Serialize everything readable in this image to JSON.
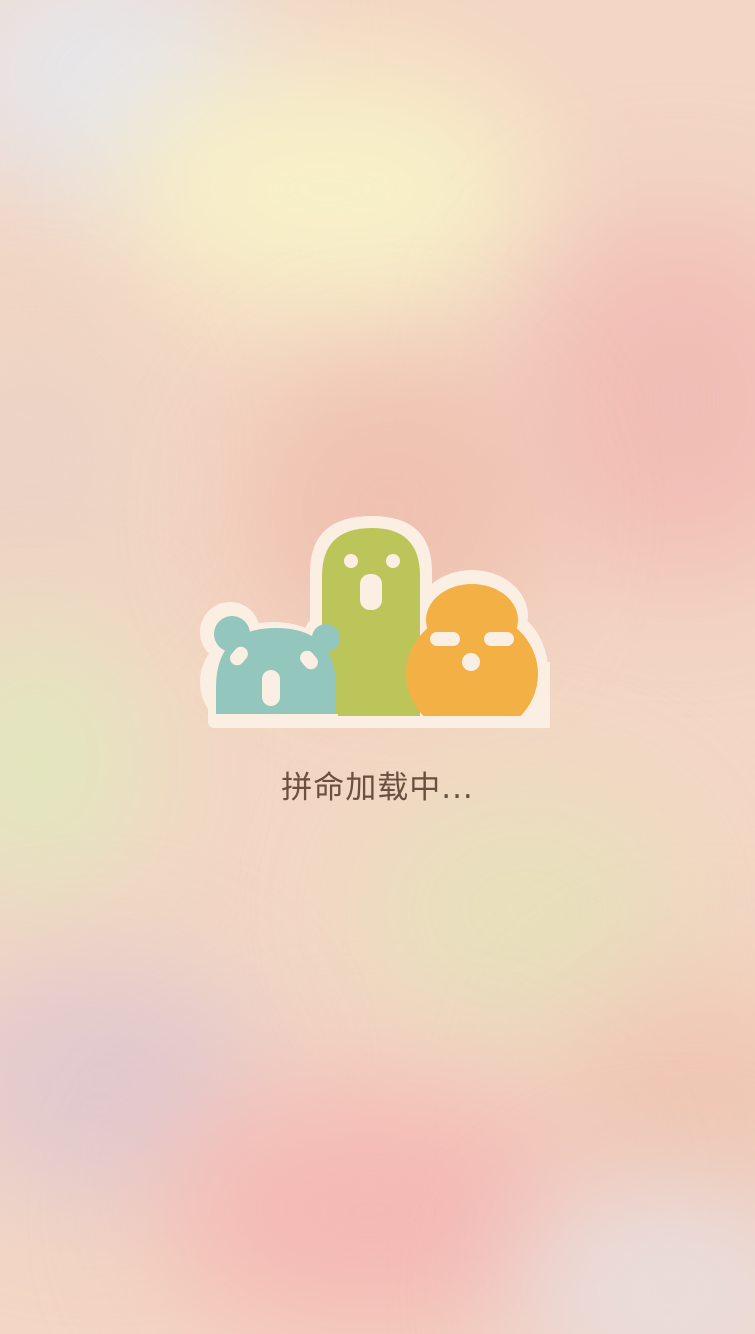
{
  "loading": {
    "text": "拼命加载中..."
  },
  "colors": {
    "outline": "#fbeee3",
    "teal_mascot": "#93c6bd",
    "green_mascot": "#bcc55a",
    "orange_mascot": "#f2b045",
    "face_features": "#fbeee3",
    "text": "#6b4f3f"
  },
  "icons": [
    "bear-mascot-icon",
    "cactus-mascot-icon",
    "orange-mascot-icon"
  ]
}
